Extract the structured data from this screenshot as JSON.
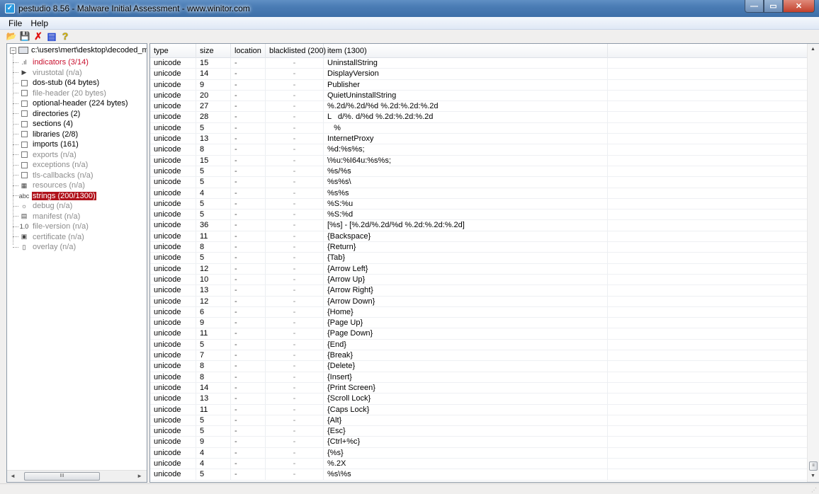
{
  "window": {
    "title": "pestudio 8.56 - Malware Initial Assessment - www.winitor.com",
    "controls": {
      "minimize": "—",
      "maximize": "▭",
      "close": "✕"
    }
  },
  "menu": [
    {
      "label": "File"
    },
    {
      "label": "Help"
    }
  ],
  "toolbar": [
    {
      "name": "open-icon",
      "glyph": "📂"
    },
    {
      "name": "save-icon",
      "glyph": "💾"
    },
    {
      "name": "delete-icon",
      "glyph": "✗"
    },
    {
      "name": "clipboard-icon",
      "glyph": "▤"
    },
    {
      "name": "help-icon",
      "glyph": "?"
    }
  ],
  "tree": {
    "root": "c:\\users\\mert\\desktop\\decoded_malw",
    "items": [
      {
        "label": "indicators (3/14)",
        "style": "red",
        "icon": "bar-chart-icon",
        "glyph": ".ıl"
      },
      {
        "label": "virustotal (n/a)",
        "style": "grey",
        "icon": "virustotal-icon",
        "glyph": "▶"
      },
      {
        "label": "dos-stub (64 bytes)",
        "style": "black",
        "icon": "node-box-icon",
        "glyph": ""
      },
      {
        "label": "file-header (20 bytes)",
        "style": "grey",
        "icon": "node-box-icon",
        "glyph": ""
      },
      {
        "label": "optional-header (224 bytes)",
        "style": "black",
        "icon": "node-box-icon",
        "glyph": ""
      },
      {
        "label": "directories (2)",
        "style": "black",
        "icon": "node-box-icon",
        "glyph": ""
      },
      {
        "label": "sections (4)",
        "style": "black",
        "icon": "node-box-icon",
        "glyph": ""
      },
      {
        "label": "libraries (2/8)",
        "style": "black",
        "icon": "node-box-icon",
        "glyph": ""
      },
      {
        "label": "imports (161)",
        "style": "black",
        "icon": "node-box-icon",
        "glyph": ""
      },
      {
        "label": "exports (n/a)",
        "style": "grey",
        "icon": "node-box-icon",
        "glyph": ""
      },
      {
        "label": "exceptions (n/a)",
        "style": "grey",
        "icon": "node-box-icon",
        "glyph": ""
      },
      {
        "label": "tls-callbacks (n/a)",
        "style": "grey",
        "icon": "node-box-icon",
        "glyph": ""
      },
      {
        "label": "resources (n/a)",
        "style": "grey",
        "icon": "resources-grid-icon",
        "glyph": "▦"
      },
      {
        "label": "strings (200/1300)",
        "style": "sel",
        "icon": "abc-icon",
        "glyph": "abc"
      },
      {
        "label": "debug (n/a)",
        "style": "grey",
        "icon": "bug-icon",
        "glyph": "☼"
      },
      {
        "label": "manifest (n/a)",
        "style": "grey",
        "icon": "manifest-icon",
        "glyph": "▤"
      },
      {
        "label": "file-version (n/a)",
        "style": "grey",
        "icon": "version-icon",
        "glyph": "1.0"
      },
      {
        "label": "certificate (n/a)",
        "style": "grey",
        "icon": "certificate-icon",
        "glyph": "▣"
      },
      {
        "label": "overlay (n/a)",
        "style": "grey",
        "icon": "document-icon",
        "glyph": "▯"
      }
    ]
  },
  "table": {
    "columns": [
      "type",
      "size",
      "location",
      "blacklisted (200)",
      "item (1300)"
    ],
    "rows": [
      [
        "unicode",
        "15",
        "-",
        "-",
        "UninstallString"
      ],
      [
        "unicode",
        "14",
        "-",
        "-",
        "DisplayVersion"
      ],
      [
        "unicode",
        "9",
        "-",
        "-",
        "Publisher"
      ],
      [
        "unicode",
        "20",
        "-",
        "-",
        "QuietUninstallString"
      ],
      [
        "unicode",
        "27",
        "-",
        "-",
        "%.2d/%.2d/%d %.2d:%.2d:%.2d"
      ],
      [
        "unicode",
        "28",
        "-",
        "-",
        "L   d/%. d/%d %.2d:%.2d:%.2d"
      ],
      [
        "unicode",
        "5",
        "-",
        "-",
        "   %"
      ],
      [
        "unicode",
        "13",
        "-",
        "-",
        "InternetProxy"
      ],
      [
        "unicode",
        "8",
        "-",
        "-",
        "%d:%s%s;"
      ],
      [
        "unicode",
        "15",
        "-",
        "-",
        "\\%u:%I64u:%s%s;"
      ],
      [
        "unicode",
        "5",
        "-",
        "-",
        "%s/%s"
      ],
      [
        "unicode",
        "5",
        "-",
        "-",
        "%s%s\\"
      ],
      [
        "unicode",
        "4",
        "-",
        "-",
        "%s%s"
      ],
      [
        "unicode",
        "5",
        "-",
        "-",
        "%S:%u"
      ],
      [
        "unicode",
        "5",
        "-",
        "-",
        "%S:%d"
      ],
      [
        "unicode",
        "36",
        "-",
        "-",
        "[%s] - [%.2d/%.2d/%d %.2d:%.2d:%.2d]"
      ],
      [
        "unicode",
        "11",
        "-",
        "-",
        "{Backspace}"
      ],
      [
        "unicode",
        "8",
        "-",
        "-",
        "{Return}"
      ],
      [
        "unicode",
        "5",
        "-",
        "-",
        "{Tab}"
      ],
      [
        "unicode",
        "12",
        "-",
        "-",
        "{Arrow Left}"
      ],
      [
        "unicode",
        "10",
        "-",
        "-",
        "{Arrow Up}"
      ],
      [
        "unicode",
        "13",
        "-",
        "-",
        "{Arrow Right}"
      ],
      [
        "unicode",
        "12",
        "-",
        "-",
        "{Arrow Down}"
      ],
      [
        "unicode",
        "6",
        "-",
        "-",
        "{Home}"
      ],
      [
        "unicode",
        "9",
        "-",
        "-",
        "{Page Up}"
      ],
      [
        "unicode",
        "11",
        "-",
        "-",
        "{Page Down}"
      ],
      [
        "unicode",
        "5",
        "-",
        "-",
        "{End}"
      ],
      [
        "unicode",
        "7",
        "-",
        "-",
        "{Break}"
      ],
      [
        "unicode",
        "8",
        "-",
        "-",
        "{Delete}"
      ],
      [
        "unicode",
        "8",
        "-",
        "-",
        "{Insert}"
      ],
      [
        "unicode",
        "14",
        "-",
        "-",
        "{Print Screen}"
      ],
      [
        "unicode",
        "13",
        "-",
        "-",
        "{Scroll Lock}"
      ],
      [
        "unicode",
        "11",
        "-",
        "-",
        "{Caps Lock}"
      ],
      [
        "unicode",
        "5",
        "-",
        "-",
        "{Alt}"
      ],
      [
        "unicode",
        "5",
        "-",
        "-",
        "{Esc}"
      ],
      [
        "unicode",
        "9",
        "-",
        "-",
        "{Ctrl+%c}"
      ],
      [
        "unicode",
        "4",
        "-",
        "-",
        "{%s}"
      ],
      [
        "unicode",
        "4",
        "-",
        "-",
        "%.2X"
      ],
      [
        "unicode",
        "5",
        "-",
        "-",
        "%s\\%s"
      ]
    ]
  },
  "colors": {
    "selected_bg": "#b0121b",
    "indicator_red": "#c8102e",
    "disabled_grey": "#8c8c8c"
  }
}
